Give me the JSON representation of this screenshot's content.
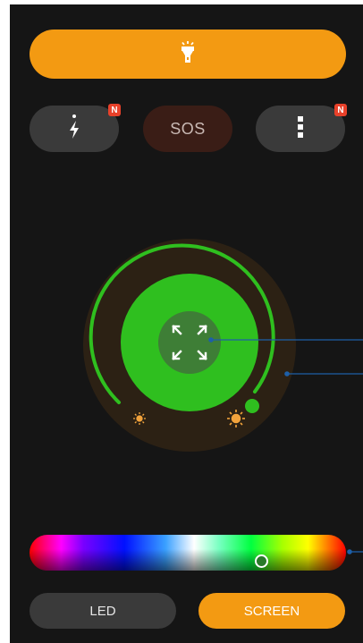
{
  "torch": {
    "icon": "flashlight-icon"
  },
  "quick_actions": [
    {
      "id": "charge",
      "icon": "charge-icon",
      "badge": "N"
    },
    {
      "id": "sos",
      "label": "SOS"
    },
    {
      "id": "more",
      "icon": "more-vertical-icon",
      "badge": "N"
    }
  ],
  "dial": {
    "center_icon": "expand-icon",
    "min_icon": "brightness-low-icon",
    "max_icon": "brightness-high-icon",
    "brightness_level": 1.0,
    "accent": "#2fbf1f",
    "indicator_color": "#f2a33c"
  },
  "color_slider": {
    "selected_position": 0.73
  },
  "modes": {
    "led_label": "LED",
    "screen_label": "SCREEN",
    "active": "SCREEN"
  },
  "colors": {
    "orange": "#f39a12",
    "green": "#2fbf1f",
    "annotation": "#1d5fa8"
  }
}
